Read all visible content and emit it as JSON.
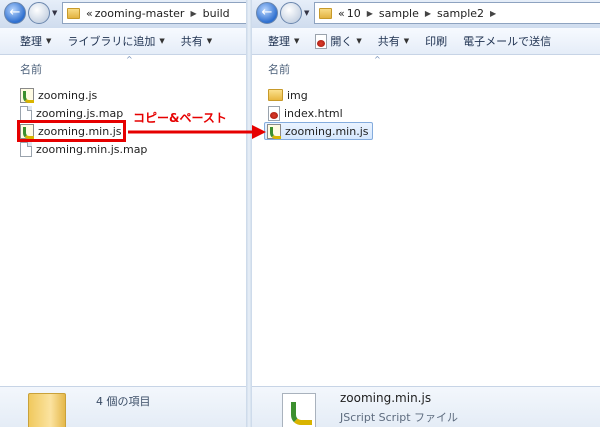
{
  "left": {
    "path": [
      "zooming-master",
      "build"
    ],
    "path_prefix": "«",
    "toolbar": [
      {
        "label": "整理",
        "dropdown": true
      },
      {
        "label": "ライブラリに追加",
        "dropdown": true
      },
      {
        "label": "共有",
        "dropdown": true
      }
    ],
    "column_header": "名前",
    "files": [
      {
        "name": "zooming.js",
        "icon": "js-file-icon"
      },
      {
        "name": "zooming.js.map",
        "icon": "document-icon"
      },
      {
        "name": "zooming.min.js",
        "icon": "js-file-icon"
      },
      {
        "name": "zooming.min.js.map",
        "icon": "document-icon"
      }
    ],
    "status": "4 個の項目"
  },
  "right": {
    "path": [
      "10",
      "sample",
      "sample2"
    ],
    "path_prefix": "«",
    "toolbar": [
      {
        "label": "整理",
        "dropdown": true
      },
      {
        "label": "開く",
        "dropdown": true
      },
      {
        "label": "共有",
        "dropdown": true
      },
      {
        "label": "印刷",
        "dropdown": false
      },
      {
        "label": "電子メールで送信",
        "dropdown": false
      }
    ],
    "column_header": "名前",
    "files": [
      {
        "name": "img",
        "icon": "folder-icon"
      },
      {
        "name": "index.html",
        "icon": "html-file-icon"
      },
      {
        "name": "zooming.min.js",
        "icon": "js-file-icon",
        "selected": true
      }
    ],
    "details": {
      "name": "zooming.min.js",
      "type": "JScript Script ファイル"
    }
  },
  "annotation": {
    "label": "コピー&ペースト",
    "color": "#e60000"
  }
}
